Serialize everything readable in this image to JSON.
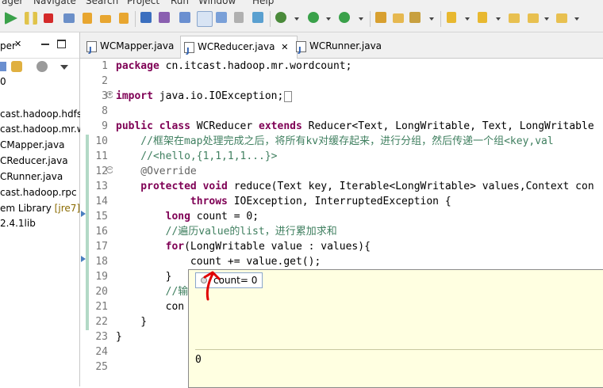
{
  "menu": [
    "ager",
    "Navigate",
    "Search",
    "Project",
    "Run",
    "Window",
    "Help"
  ],
  "left_panel": {
    "tab_title": "per",
    "close": "✕",
    "number": "0",
    "items": [
      {
        "label": "cast.hadoop.hdfs"
      },
      {
        "label": "cast.hadoop.mr.w"
      },
      {
        "label": "CMapper.java"
      },
      {
        "label": "CReducer.java"
      },
      {
        "label": "CRunner.java"
      },
      {
        "label": "cast.hadoop.rpc"
      },
      {
        "label": "em Library ",
        "suffix": "[jre7]"
      },
      {
        "label": "2.4.1lib"
      }
    ]
  },
  "editor_tabs": [
    {
      "label": "WCMapper.java",
      "active": false
    },
    {
      "label": "WCReducer.java",
      "active": true,
      "close": "✕"
    },
    {
      "label": "WCRunner.java",
      "active": false
    }
  ],
  "line_numbers": [
    "1",
    "2",
    "3",
    "8",
    "9",
    "10",
    "11",
    "12",
    "13",
    "14",
    "15",
    "16",
    "17",
    "18",
    "19",
    "20",
    "21",
    "22",
    "23",
    "24",
    "25"
  ],
  "code": {
    "l1_kw": "package",
    "l1": " cn.itcast.hadoop.mr.wordcount;",
    "l3_kw": "import",
    "l3": " java.io.IOException;",
    "l9_kw1": "public class",
    "l9_a": " WCReducer ",
    "l9_kw2": "extends",
    "l9_b": " Reducer<Text, LongWritable, Text, LongWritable",
    "l10": "    //框架在map处理完成之后，将所有kv对缓存起来，进行分组，然后传递一个组<key,val",
    "l11": "    //<hello,{1,1,1,1...}>",
    "l12": "    @Override",
    "l13_kw": "    protected void",
    "l13": " reduce(Text key, Iterable<LongWritable> values,Context con",
    "l14_kw": "            throws",
    "l14": " IOException, InterruptedException {",
    "l15_kw": "        long",
    "l15": " count = 0;",
    "l16": "        //遍历value的list，进行累加求和",
    "l17_kw": "        for",
    "l17": "(LongWritable value : values){",
    "l18": "            count += value.get();",
    "l19": "        }",
    "l20": "        //输",
    "l21": "        con",
    "l22": "    }",
    "l23": "}"
  },
  "hover": {
    "variable": "count= 0",
    "detail": "0"
  },
  "colors": {
    "keyword": "#7f0055",
    "comment": "#3f7f5f",
    "current_line": "#c6dba8",
    "hover_bg": "#ffffe1",
    "annotation_arrow": "#e00000"
  }
}
